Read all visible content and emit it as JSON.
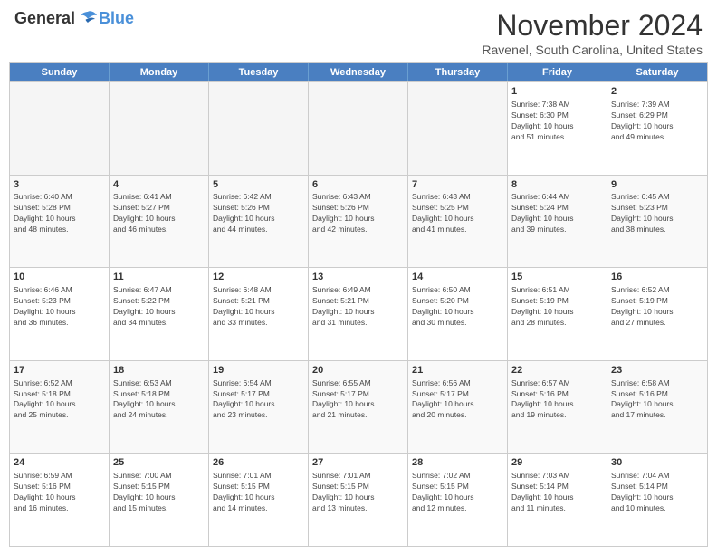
{
  "header": {
    "logo_general": "General",
    "logo_blue": "Blue",
    "month_title": "November 2024",
    "location": "Ravenel, South Carolina, United States"
  },
  "calendar": {
    "days_of_week": [
      "Sunday",
      "Monday",
      "Tuesday",
      "Wednesday",
      "Thursday",
      "Friday",
      "Saturday"
    ],
    "weeks": [
      [
        {
          "day": "",
          "empty": true
        },
        {
          "day": "",
          "empty": true
        },
        {
          "day": "",
          "empty": true
        },
        {
          "day": "",
          "empty": true
        },
        {
          "day": "",
          "empty": true
        },
        {
          "day": "1",
          "info": "Sunrise: 7:38 AM\nSunset: 6:30 PM\nDaylight: 10 hours\nand 51 minutes."
        },
        {
          "day": "2",
          "info": "Sunrise: 7:39 AM\nSunset: 6:29 PM\nDaylight: 10 hours\nand 49 minutes."
        }
      ],
      [
        {
          "day": "3",
          "info": "Sunrise: 6:40 AM\nSunset: 5:28 PM\nDaylight: 10 hours\nand 48 minutes."
        },
        {
          "day": "4",
          "info": "Sunrise: 6:41 AM\nSunset: 5:27 PM\nDaylight: 10 hours\nand 46 minutes."
        },
        {
          "day": "5",
          "info": "Sunrise: 6:42 AM\nSunset: 5:26 PM\nDaylight: 10 hours\nand 44 minutes."
        },
        {
          "day": "6",
          "info": "Sunrise: 6:43 AM\nSunset: 5:26 PM\nDaylight: 10 hours\nand 42 minutes."
        },
        {
          "day": "7",
          "info": "Sunrise: 6:43 AM\nSunset: 5:25 PM\nDaylight: 10 hours\nand 41 minutes."
        },
        {
          "day": "8",
          "info": "Sunrise: 6:44 AM\nSunset: 5:24 PM\nDaylight: 10 hours\nand 39 minutes."
        },
        {
          "day": "9",
          "info": "Sunrise: 6:45 AM\nSunset: 5:23 PM\nDaylight: 10 hours\nand 38 minutes."
        }
      ],
      [
        {
          "day": "10",
          "info": "Sunrise: 6:46 AM\nSunset: 5:23 PM\nDaylight: 10 hours\nand 36 minutes."
        },
        {
          "day": "11",
          "info": "Sunrise: 6:47 AM\nSunset: 5:22 PM\nDaylight: 10 hours\nand 34 minutes."
        },
        {
          "day": "12",
          "info": "Sunrise: 6:48 AM\nSunset: 5:21 PM\nDaylight: 10 hours\nand 33 minutes."
        },
        {
          "day": "13",
          "info": "Sunrise: 6:49 AM\nSunset: 5:21 PM\nDaylight: 10 hours\nand 31 minutes."
        },
        {
          "day": "14",
          "info": "Sunrise: 6:50 AM\nSunset: 5:20 PM\nDaylight: 10 hours\nand 30 minutes."
        },
        {
          "day": "15",
          "info": "Sunrise: 6:51 AM\nSunset: 5:19 PM\nDaylight: 10 hours\nand 28 minutes."
        },
        {
          "day": "16",
          "info": "Sunrise: 6:52 AM\nSunset: 5:19 PM\nDaylight: 10 hours\nand 27 minutes."
        }
      ],
      [
        {
          "day": "17",
          "info": "Sunrise: 6:52 AM\nSunset: 5:18 PM\nDaylight: 10 hours\nand 25 minutes."
        },
        {
          "day": "18",
          "info": "Sunrise: 6:53 AM\nSunset: 5:18 PM\nDaylight: 10 hours\nand 24 minutes."
        },
        {
          "day": "19",
          "info": "Sunrise: 6:54 AM\nSunset: 5:17 PM\nDaylight: 10 hours\nand 23 minutes."
        },
        {
          "day": "20",
          "info": "Sunrise: 6:55 AM\nSunset: 5:17 PM\nDaylight: 10 hours\nand 21 minutes."
        },
        {
          "day": "21",
          "info": "Sunrise: 6:56 AM\nSunset: 5:17 PM\nDaylight: 10 hours\nand 20 minutes."
        },
        {
          "day": "22",
          "info": "Sunrise: 6:57 AM\nSunset: 5:16 PM\nDaylight: 10 hours\nand 19 minutes."
        },
        {
          "day": "23",
          "info": "Sunrise: 6:58 AM\nSunset: 5:16 PM\nDaylight: 10 hours\nand 17 minutes."
        }
      ],
      [
        {
          "day": "24",
          "info": "Sunrise: 6:59 AM\nSunset: 5:16 PM\nDaylight: 10 hours\nand 16 minutes."
        },
        {
          "day": "25",
          "info": "Sunrise: 7:00 AM\nSunset: 5:15 PM\nDaylight: 10 hours\nand 15 minutes."
        },
        {
          "day": "26",
          "info": "Sunrise: 7:01 AM\nSunset: 5:15 PM\nDaylight: 10 hours\nand 14 minutes."
        },
        {
          "day": "27",
          "info": "Sunrise: 7:01 AM\nSunset: 5:15 PM\nDaylight: 10 hours\nand 13 minutes."
        },
        {
          "day": "28",
          "info": "Sunrise: 7:02 AM\nSunset: 5:15 PM\nDaylight: 10 hours\nand 12 minutes."
        },
        {
          "day": "29",
          "info": "Sunrise: 7:03 AM\nSunset: 5:14 PM\nDaylight: 10 hours\nand 11 minutes."
        },
        {
          "day": "30",
          "info": "Sunrise: 7:04 AM\nSunset: 5:14 PM\nDaylight: 10 hours\nand 10 minutes."
        }
      ]
    ]
  }
}
